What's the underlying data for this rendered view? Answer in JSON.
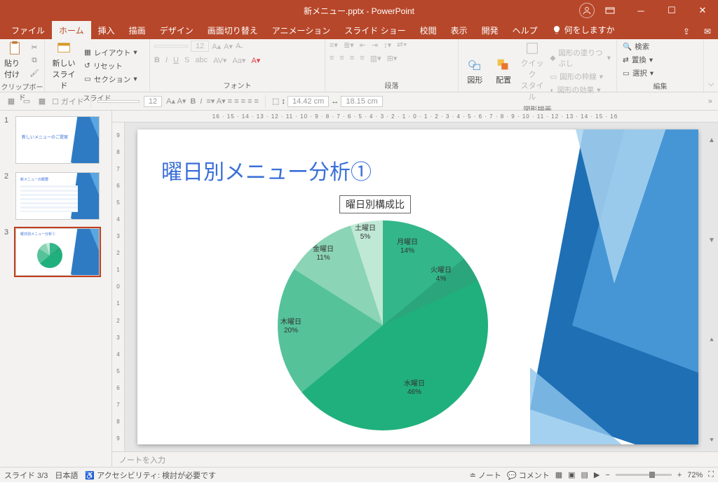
{
  "title": "新メニュー.pptx  -  PowerPoint",
  "tabs": [
    "ファイル",
    "ホーム",
    "挿入",
    "描画",
    "デザイン",
    "画面切り替え",
    "アニメーション",
    "スライド ショー",
    "校閲",
    "表示",
    "開発",
    "ヘルプ"
  ],
  "activeTab": 1,
  "tellme": "何をしますか",
  "ribbon": {
    "clipboard": {
      "label": "クリップボード",
      "paste": "貼り付け"
    },
    "slides": {
      "label": "スライド",
      "new": "新しい\nスライド",
      "layout": "レイアウト",
      "reset": "リセット",
      "section": "セクション"
    },
    "font": {
      "label": "フォント",
      "size": "12"
    },
    "paragraph": {
      "label": "段落"
    },
    "drawing": {
      "label": "図形描画",
      "shapes": "図形",
      "arrange": "配置",
      "quick": "クイック\nスタイル",
      "fill": "図形の塗りつぶし",
      "outline": "図形の枠線",
      "effects": "図形の効果"
    },
    "editing": {
      "label": "編集",
      "find": "検索",
      "replace": "置換",
      "select": "選択"
    }
  },
  "toolbar2": {
    "guide": "ガイド",
    "fontsize": "12",
    "w": "14.42 cm",
    "h": "18.15 cm"
  },
  "ruler": "16 · 15 · 14 · 13 · 12 · 11 · 10 · 9 · 8 · 7 · 6 · 5 · 4 · 3 · 2 · 1 · 0 · 1 · 2 · 3 · 4 · 5 · 6 · 7 · 8 · 9 · 10 · 11 · 12 · 13 · 14 · 15 · 16",
  "rulerV": [
    "9",
    "8",
    "7",
    "6",
    "5",
    "4",
    "3",
    "2",
    "1",
    "0",
    "1",
    "2",
    "3",
    "4",
    "5",
    "6",
    "7",
    "8",
    "9"
  ],
  "slideTitle": "曜日別メニュー分析①",
  "chartTitle": "曜日別構成比",
  "chart_data": {
    "type": "pie",
    "title": "曜日別構成比",
    "categories": [
      "月曜日",
      "火曜日",
      "水曜日",
      "木曜日",
      "金曜日",
      "土曜日"
    ],
    "values": [
      14,
      4,
      46,
      20,
      11,
      5
    ],
    "colors": [
      "#32b68a",
      "#2aa57c",
      "#20b07d",
      "#55c29a",
      "#8bd4b5",
      "#bfe8d5"
    ]
  },
  "labels": {
    "mon": "月曜日\n14%",
    "tue": "火曜日\n4%",
    "wed": "水曜日\n46%",
    "thu": "木曜日\n20%",
    "fri": "金曜日\n11%",
    "sat": "土曜日\n5%"
  },
  "notes": "ノートを入力",
  "status": {
    "slide": "スライド 3/3",
    "lang": "日本語",
    "a11y": "アクセシビリティ: 検討が必要です",
    "notesBtn": "ノート",
    "comments": "コメント",
    "zoom": "72%"
  }
}
